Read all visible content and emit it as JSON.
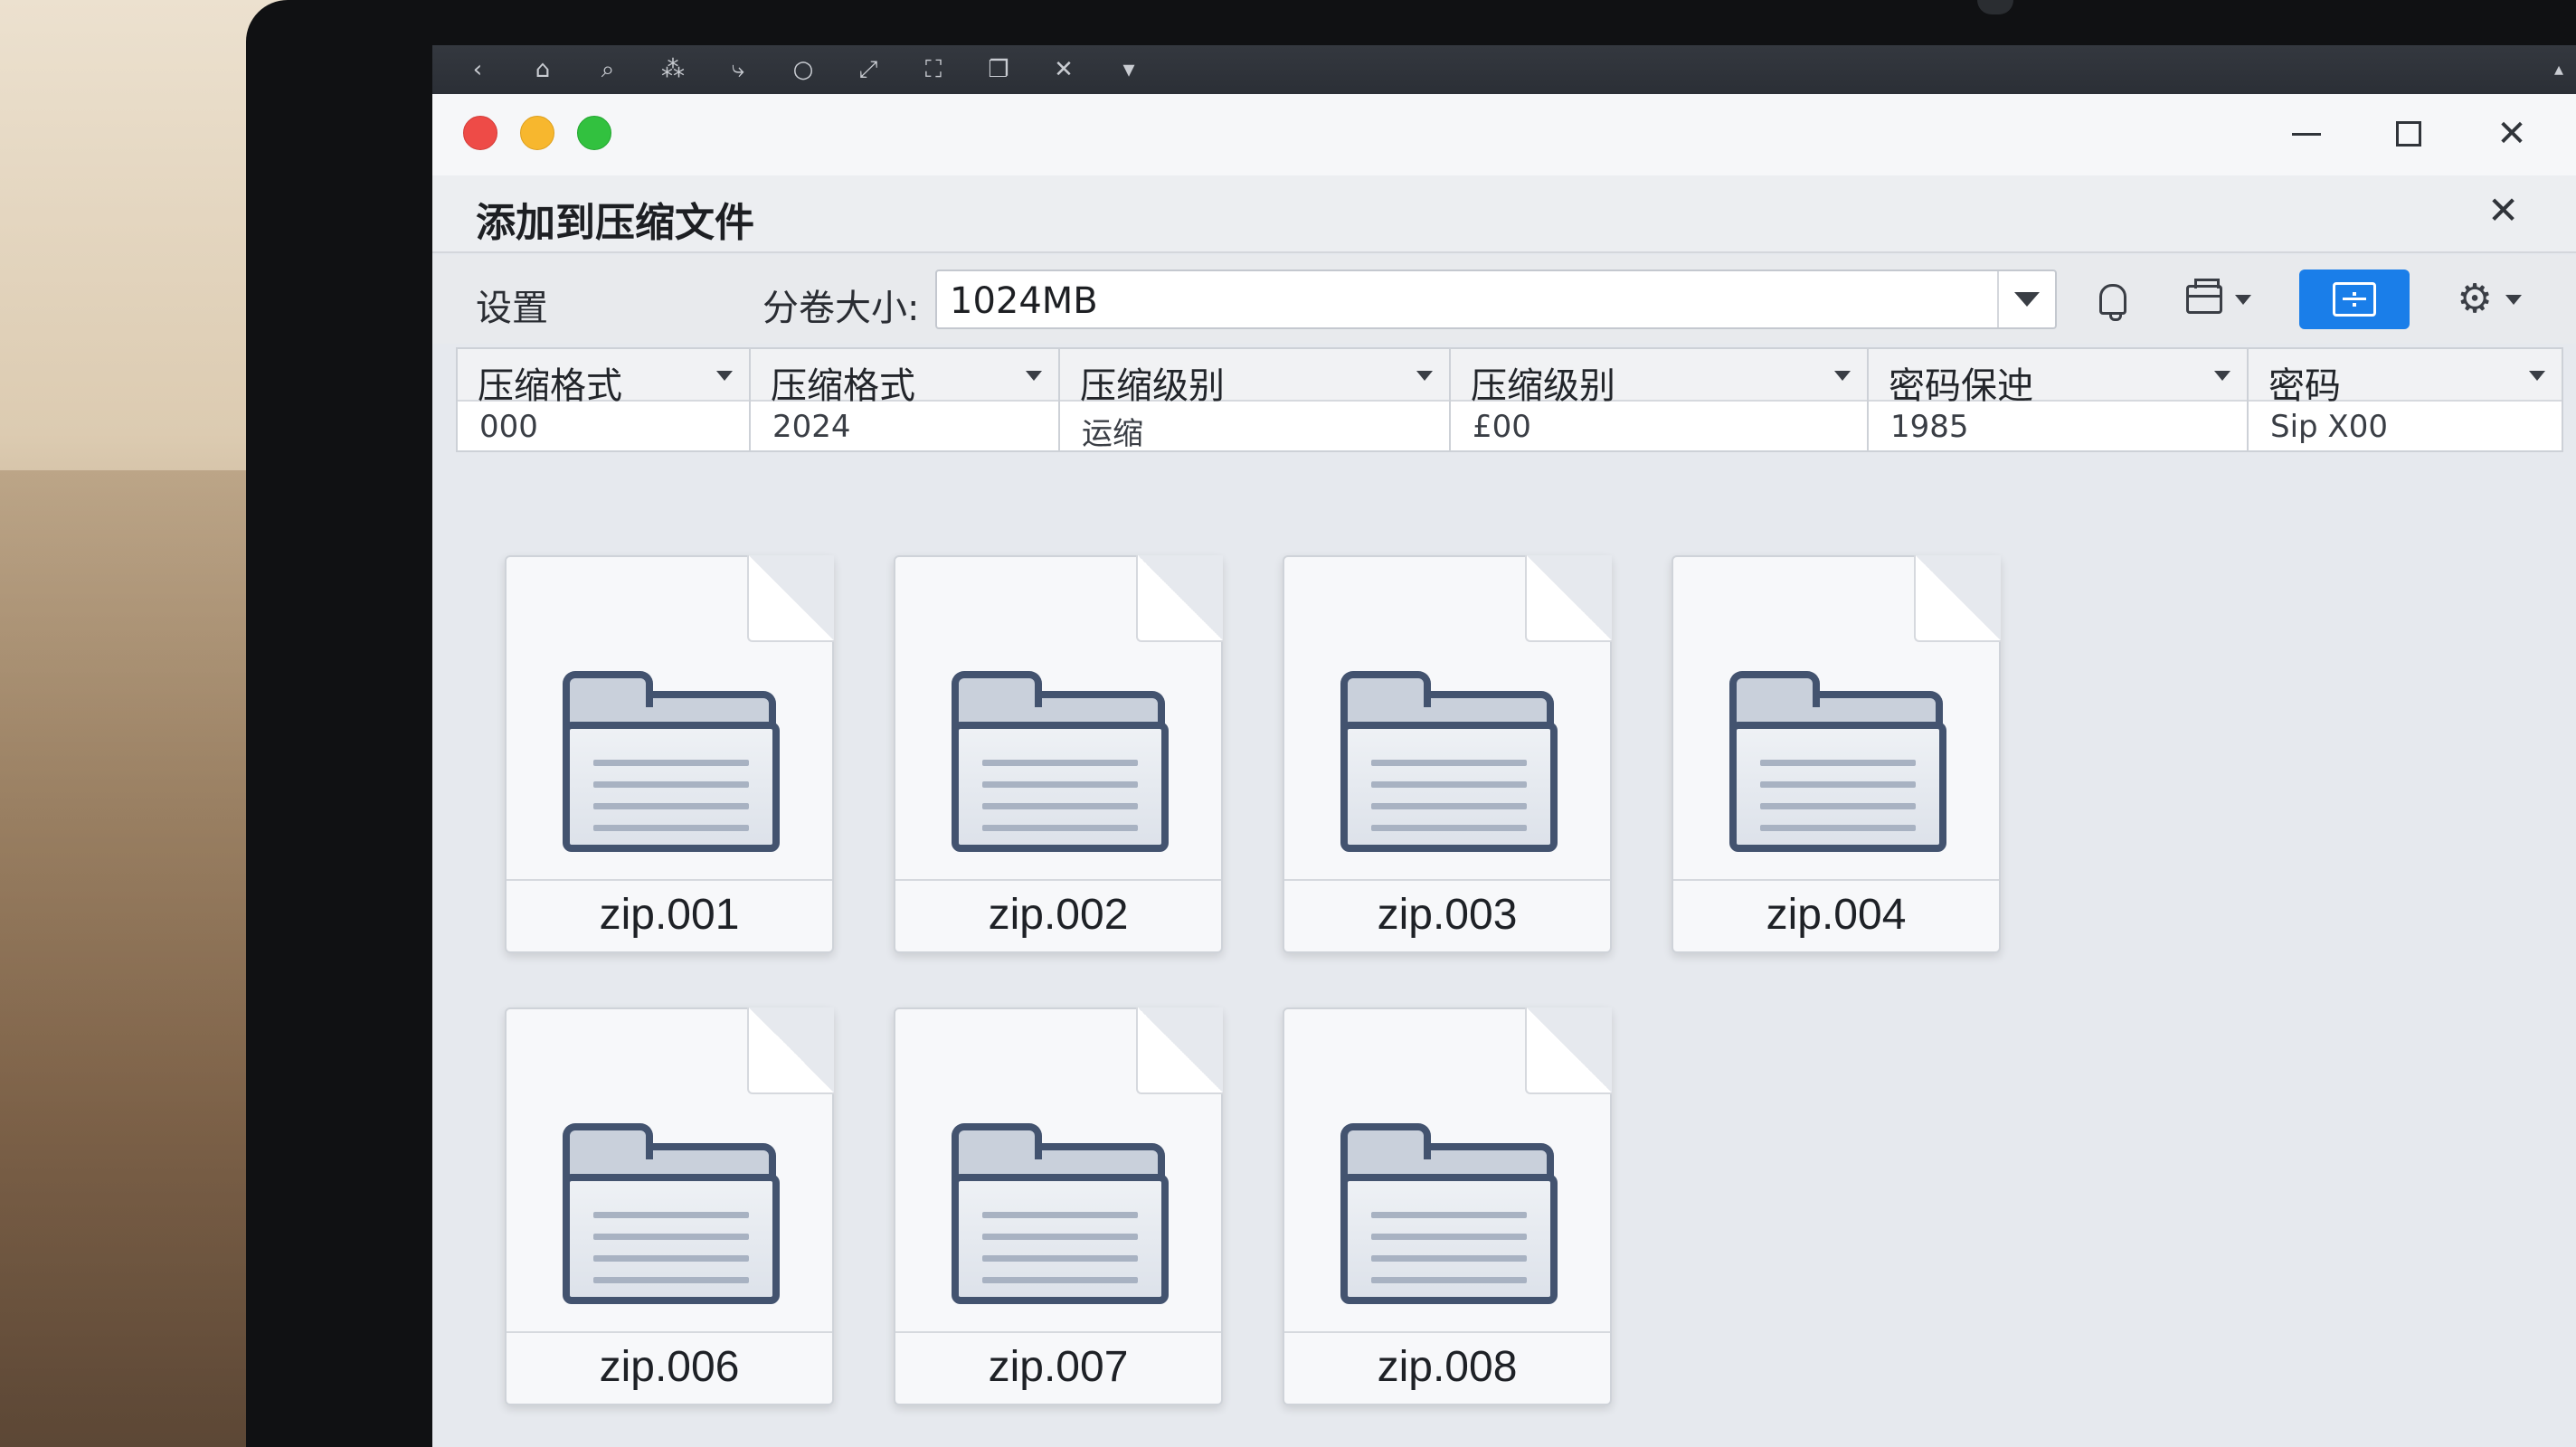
{
  "toolbar": {
    "icons": [
      "back-icon",
      "home-icon",
      "search-icon",
      "shuffle-icon",
      "share-icon",
      "zoom-icon",
      "expand-icon",
      "fullscreen-icon",
      "window-icon",
      "tools-icon",
      "more-icon"
    ]
  },
  "window": {
    "traffic_lights": [
      "#ee4b47",
      "#f7b72e",
      "#32c13f"
    ]
  },
  "dialog": {
    "title": "添加到压缩文件",
    "settings_label": "设置",
    "volume_label": "分卷大小:",
    "volume_value": "1024MB",
    "accent_color": "#1a7ee9"
  },
  "options": [
    {
      "header": "压缩格式",
      "value": "000"
    },
    {
      "header": "压缩格式",
      "value": "2024"
    },
    {
      "header": "压缩级别",
      "value": "运缩"
    },
    {
      "header": "压缩级别",
      "value": "£00"
    },
    {
      "header": "密码保迚",
      "value": "1985"
    },
    {
      "header": "密码",
      "value": "Sip X00"
    }
  ],
  "files": [
    {
      "name": "zip.001"
    },
    {
      "name": "zip.002"
    },
    {
      "name": "zip.003"
    },
    {
      "name": "zip.004"
    },
    {
      "name": "zip.006"
    },
    {
      "name": "zip.007"
    },
    {
      "name": "zip.008"
    }
  ]
}
